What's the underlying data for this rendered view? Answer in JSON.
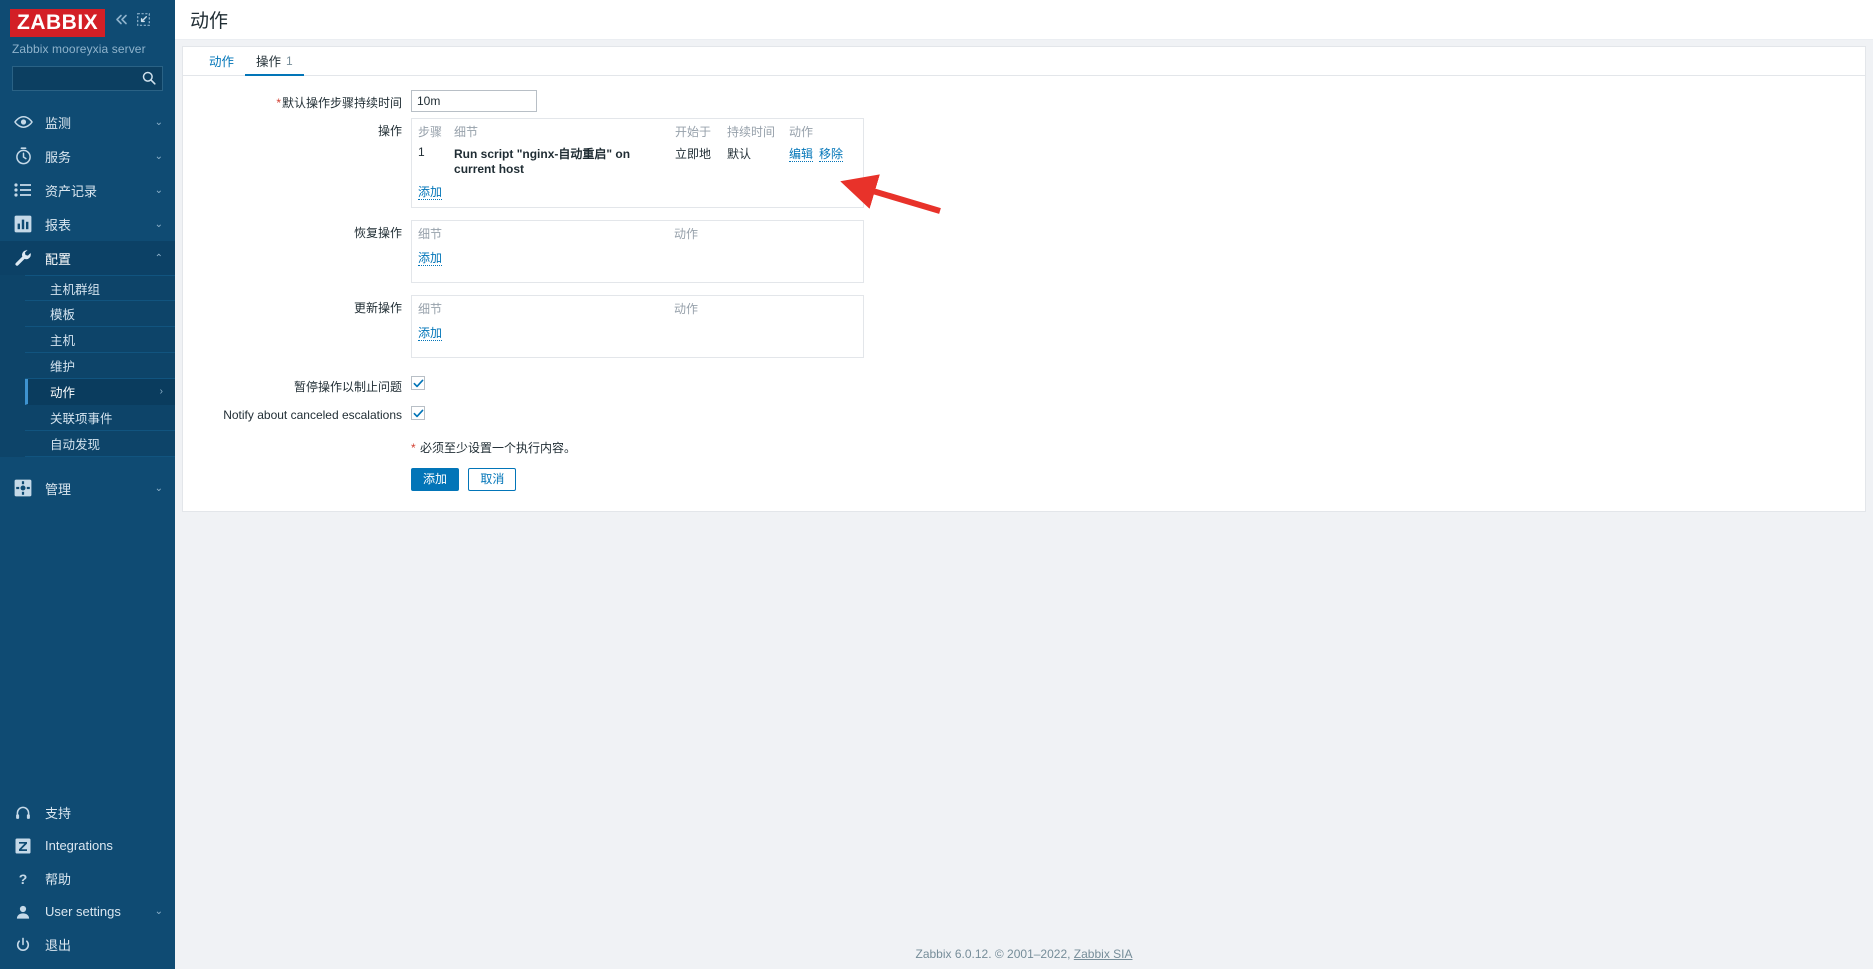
{
  "sidebar": {
    "logo_text": "ZABBIX",
    "collapse_icon": "chevron-double-left-icon",
    "compact_icon": "collapse-view-icon",
    "server_name": "Zabbix mooreyxia server",
    "search": {
      "value": "",
      "placeholder": "",
      "icon": "search-icon"
    },
    "nav": [
      {
        "label": "监测",
        "icon": "eye-icon",
        "chevron": "chevron-down-icon",
        "expanded": false
      },
      {
        "label": "服务",
        "icon": "service-clock-icon",
        "chevron": "chevron-down-icon",
        "expanded": false
      },
      {
        "label": "资产记录",
        "icon": "list-icon",
        "chevron": "chevron-down-icon",
        "expanded": false
      },
      {
        "label": "报表",
        "icon": "bar-chart-icon",
        "chevron": "chevron-down-icon",
        "expanded": false
      },
      {
        "label": "配置",
        "icon": "wrench-icon",
        "chevron": "chevron-up-icon",
        "expanded": true
      }
    ],
    "sub_items": [
      {
        "label": "主机群组",
        "selected": false,
        "chevron": ""
      },
      {
        "label": "模板",
        "selected": false,
        "chevron": ""
      },
      {
        "label": "主机",
        "selected": false,
        "chevron": ""
      },
      {
        "label": "维护",
        "selected": false,
        "chevron": ""
      },
      {
        "label": "动作",
        "selected": true,
        "chevron": "chevron-right-icon"
      },
      {
        "label": "关联项事件",
        "selected": false,
        "chevron": ""
      },
      {
        "label": "自动发现",
        "selected": false,
        "chevron": ""
      }
    ],
    "nav_after": [
      {
        "label": "管理",
        "icon": "gear-icon",
        "chevron": "chevron-down-icon",
        "expanded": false
      }
    ],
    "bottom_nav": [
      {
        "label": "支持",
        "icon": "headset-icon",
        "chevron": ""
      },
      {
        "label": "Integrations",
        "icon": "zabbix-z-icon",
        "chevron": ""
      },
      {
        "label": "帮助",
        "icon": "question-icon",
        "chevron": ""
      },
      {
        "label": "User settings",
        "icon": "user-icon",
        "chevron": "chevron-down-icon"
      },
      {
        "label": "退出",
        "icon": "power-icon",
        "chevron": ""
      }
    ]
  },
  "header": {
    "title": "动作"
  },
  "tabs": [
    {
      "label": "动作",
      "count": "",
      "active": false
    },
    {
      "label": "操作",
      "count": "1",
      "active": true
    }
  ],
  "form": {
    "default_duration": {
      "label": "默认操作步骤持续时间",
      "required": true,
      "value": "10m",
      "placeholder": ""
    },
    "operations": {
      "label": "操作",
      "columns": {
        "step": "步骤",
        "details": "细节",
        "start_in": "开始于",
        "duration": "持续时间",
        "action": "动作"
      },
      "rows": [
        {
          "step": "1",
          "details": "Run script \"nginx-自动重启\" on current host",
          "start_in": "立即地",
          "duration": "默认",
          "edit_label": "编辑",
          "remove_label": "移除"
        }
      ],
      "add_label": "添加"
    },
    "recovery_operations": {
      "label": "恢复操作",
      "columns": {
        "details": "细节",
        "action": "动作"
      },
      "rows": [],
      "add_label": "添加"
    },
    "update_operations": {
      "label": "更新操作",
      "columns": {
        "details": "细节",
        "action": "动作"
      },
      "rows": [],
      "add_label": "添加"
    },
    "pause_suppressed": {
      "label": "暂停操作以制止问题",
      "checked": true
    },
    "notify_canceled": {
      "label": "Notify about canceled escalations",
      "checked": true
    },
    "hint": {
      "marker": "*",
      "text": "必须至少设置一个执行内容。"
    },
    "buttons": {
      "submit": "添加",
      "cancel": "取消"
    }
  },
  "footer": {
    "text": "Zabbix 6.0.12. © 2001–2022, ",
    "link": "Zabbix SIA"
  },
  "colors": {
    "sidebar_bg": "#0f4b73",
    "brand_red": "#d31f26",
    "accent_blue": "#0275b8",
    "required_red": "#d23f31",
    "annotation_arrow": "#e8322a"
  }
}
